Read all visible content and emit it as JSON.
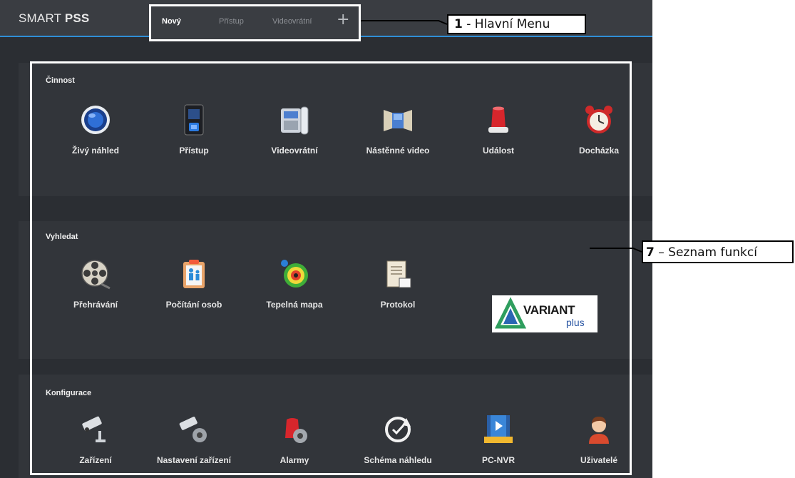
{
  "app": {
    "brand_light": "SMART ",
    "brand_bold": "PSS"
  },
  "tabs": [
    {
      "label": "Nový",
      "active": true
    },
    {
      "label": "Přístup",
      "active": false
    },
    {
      "label": "Videovrátní",
      "active": false
    }
  ],
  "add_tab_symbol": "+",
  "annotations": {
    "menu": {
      "number": "1",
      "text": " - Hlavní Menu"
    },
    "functions": {
      "number": "7",
      "text": " – Seznam funkcí"
    }
  },
  "sections": [
    {
      "title": "Činnost",
      "items": [
        {
          "label": "Živý náhled",
          "icon": "live-view-lens-icon"
        },
        {
          "label": "Přístup",
          "icon": "access-terminal-icon"
        },
        {
          "label": "Videovrátní",
          "icon": "video-intercom-icon"
        },
        {
          "label": "Nástěnné video",
          "icon": "video-wall-icon"
        },
        {
          "label": "Událost",
          "icon": "alarm-siren-icon"
        },
        {
          "label": "Docházka",
          "icon": "alarm-clock-icon"
        }
      ]
    },
    {
      "title": "Vyhledat",
      "items": [
        {
          "label": "Přehrávání",
          "icon": "film-reel-icon"
        },
        {
          "label": "Počítání osob",
          "icon": "people-counting-icon"
        },
        {
          "label": "Tepelná mapa",
          "icon": "heat-map-icon"
        },
        {
          "label": "Protokol",
          "icon": "log-document-icon"
        }
      ],
      "logo": {
        "word": "VARIANT",
        "sub": "plus"
      }
    },
    {
      "title": "Konfigurace",
      "items": [
        {
          "label": "Zařízení",
          "icon": "camera-device-icon"
        },
        {
          "label": "Nastavení zařízení",
          "icon": "camera-settings-icon"
        },
        {
          "label": "Alarmy",
          "icon": "alarm-settings-icon"
        },
        {
          "label": "Schéma náhledu",
          "icon": "tour-refresh-icon"
        },
        {
          "label": "PC-NVR",
          "icon": "pc-nvr-icon"
        },
        {
          "label": "Uživatelé",
          "icon": "user-icon"
        }
      ]
    }
  ]
}
